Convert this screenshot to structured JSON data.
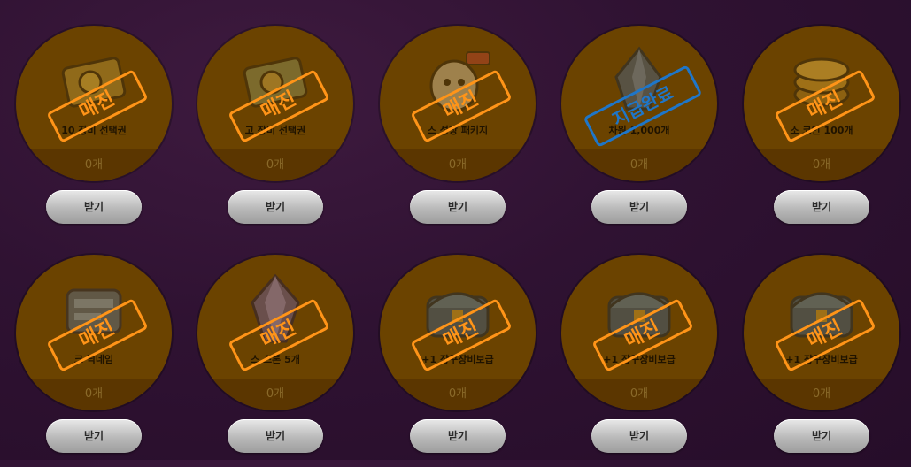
{
  "items": [
    {
      "name": "10 장비 선택권",
      "qty": "0개",
      "stamp": "매진",
      "stamp_type": "sold-out",
      "button": "받기",
      "icon": "ticket-icon"
    },
    {
      "name": "고 장비 선택권",
      "qty": "0개",
      "stamp": "매진",
      "stamp_type": "sold-out",
      "button": "받기",
      "icon": "ticket-icon"
    },
    {
      "name": "스 성장 패키지",
      "qty": "0개",
      "stamp": "매진",
      "stamp_type": "sold-out",
      "button": "받기",
      "icon": "character-package-icon"
    },
    {
      "name": "차원 1,000개",
      "qty": "0개",
      "stamp": "지급완료",
      "stamp_type": "paid",
      "button": "받기",
      "icon": "crystal-icon"
    },
    {
      "name": "소 코인 100개",
      "qty": "0개",
      "stamp": "매진",
      "stamp_type": "sold-out",
      "button": "받기",
      "icon": "coin-icon"
    },
    {
      "name": "크 닉네임",
      "qty": "0개",
      "stamp": "매진",
      "stamp_type": "sold-out",
      "button": "받기",
      "icon": "nickname-tag-icon"
    },
    {
      "name": "스 스톤 5개",
      "qty": "0개",
      "stamp": "매진",
      "stamp_type": "sold-out",
      "button": "받기",
      "icon": "gem-stone-icon"
    },
    {
      "name": "+1 장구장비보급",
      "qty": "0개",
      "stamp": "매진",
      "stamp_type": "sold-out",
      "button": "받기",
      "icon": "equipment-chest-icon"
    },
    {
      "name": "+1 장구장비보급",
      "qty": "0개",
      "stamp": "매진",
      "stamp_type": "sold-out",
      "button": "받기",
      "icon": "equipment-chest-icon"
    },
    {
      "name": "+1 장구장비보급",
      "qty": "0개",
      "stamp": "매진",
      "stamp_type": "sold-out",
      "button": "받기",
      "icon": "equipment-chest-icon"
    }
  ],
  "colors": {
    "sold_out_stamp": "#ff9418",
    "paid_stamp": "#1e76c9",
    "circle": "#6b4300"
  }
}
